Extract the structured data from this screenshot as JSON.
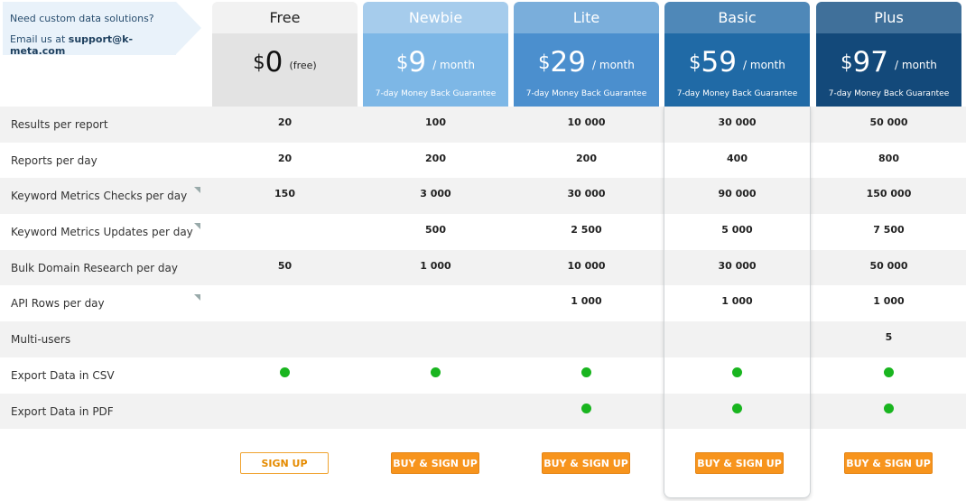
{
  "contact": {
    "line1": "Need custom data solutions?",
    "line2_prefix": "Email us at",
    "email": "support@k-meta.com"
  },
  "plans": [
    {
      "name": "Free",
      "currency": "$",
      "amount": "0",
      "period": "(free)",
      "guarantee": "",
      "button": "SIGN UP"
    },
    {
      "name": "Newbie",
      "currency": "$",
      "amount": "9",
      "period": "/ month",
      "guarantee": "7-day Money Back Guarantee",
      "button": "BUY & SIGN UP"
    },
    {
      "name": "Lite",
      "currency": "$",
      "amount": "29",
      "period": "/ month",
      "guarantee": "7-day Money Back Guarantee",
      "button": "BUY & SIGN UP"
    },
    {
      "name": "Basic",
      "currency": "$",
      "amount": "59",
      "period": "/ month",
      "guarantee": "7-day Money Back Guarantee",
      "button": "BUY & SIGN UP"
    },
    {
      "name": "Plus",
      "currency": "$",
      "amount": "97",
      "period": "/ month",
      "guarantee": "7-day Money Back Guarantee",
      "button": "BUY & SIGN UP"
    }
  ],
  "features": [
    {
      "label": "Results per report",
      "tip": false,
      "values": [
        "20",
        "100",
        "10 000",
        "30 000",
        "50 000"
      ]
    },
    {
      "label": "Reports per day",
      "tip": false,
      "values": [
        "20",
        "200",
        "200",
        "400",
        "800"
      ]
    },
    {
      "label": "Keyword Metrics Checks per day",
      "tip": true,
      "values": [
        "150",
        "3 000",
        "30 000",
        "90 000",
        "150 000"
      ]
    },
    {
      "label": "Keyword Metrics Updates per day",
      "tip": true,
      "values": [
        "",
        "500",
        "2 500",
        "5 000",
        "7 500"
      ]
    },
    {
      "label": "Bulk Domain Research per day",
      "tip": false,
      "values": [
        "50",
        "1 000",
        "10 000",
        "30 000",
        "50 000"
      ]
    },
    {
      "label": "API Rows per day",
      "tip": true,
      "values": [
        "",
        "",
        "1 000",
        "1 000",
        "1 000"
      ]
    },
    {
      "label": "Multi-users",
      "tip": false,
      "values": [
        "",
        "",
        "",
        "",
        "5"
      ]
    },
    {
      "label": "Export Data in CSV",
      "tip": false,
      "values": [
        "check",
        "check",
        "check",
        "check",
        "check"
      ]
    },
    {
      "label": "Export Data in PDF",
      "tip": false,
      "values": [
        "",
        "",
        "check",
        "check",
        "check"
      ]
    }
  ],
  "colors": {
    "check": "#19b51f",
    "button": "#f7941d"
  }
}
